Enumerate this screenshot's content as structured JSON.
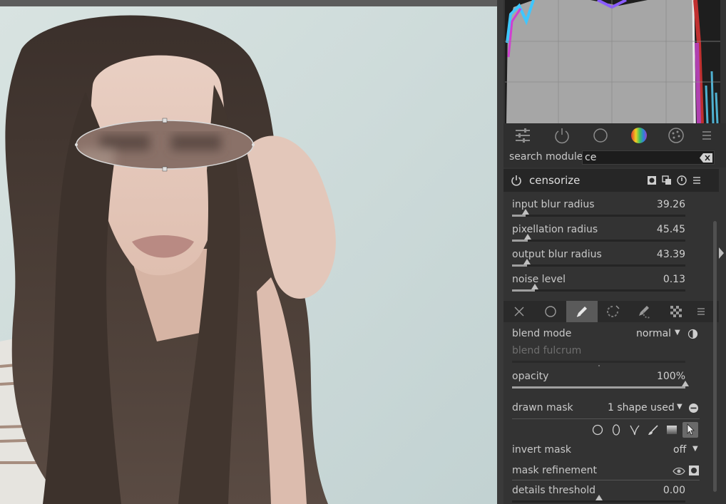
{
  "histogram": {
    "label": "histogram"
  },
  "module_groups": [
    {
      "icon": "sliders-icon"
    },
    {
      "icon": "power-icon"
    },
    {
      "icon": "circle-icon"
    },
    {
      "icon": "color-wheel-icon"
    },
    {
      "icon": "palette-icon"
    },
    {
      "icon": "menu-icon"
    }
  ],
  "search": {
    "label": "search module",
    "value": "ce"
  },
  "module": {
    "title": "censorize",
    "sliders": [
      {
        "label": "input blur radius",
        "value": "39.26",
        "fraction": 0.08
      },
      {
        "label": "pixellation radius",
        "value": "45.45",
        "fraction": 0.09
      },
      {
        "label": "output blur radius",
        "value": "43.39",
        "fraction": 0.087
      },
      {
        "label": "noise level",
        "value": "0.13",
        "fraction": 0.13
      }
    ]
  },
  "blend": {
    "tabs": [
      "off-icon",
      "uniform-icon",
      "drawn-mask-icon",
      "parametric-mask-icon",
      "drawn-parametric-icon",
      "raster-mask-icon",
      "menu-icon"
    ],
    "active_tab": 2,
    "blend_mode_label": "blend mode",
    "blend_mode_value": "normal",
    "blend_fulcrum_label": "blend fulcrum",
    "opacity_label": "opacity",
    "opacity_value": "100%",
    "opacity_fraction": 1.0,
    "drawn_mask_label": "drawn mask",
    "drawn_mask_value": "1 shape used",
    "shape_tools": [
      "circle-shape-icon",
      "ellipse-shape-icon",
      "path-shape-icon",
      "brush-shape-icon",
      "gradient-shape-icon",
      "edit-shapes-icon"
    ],
    "invert_mask_label": "invert mask",
    "invert_mask_value": "off",
    "mask_refinement_label": "mask refinement",
    "details_threshold_label": "details threshold",
    "details_threshold_value": "0.00",
    "details_threshold_fraction": 0.5
  }
}
